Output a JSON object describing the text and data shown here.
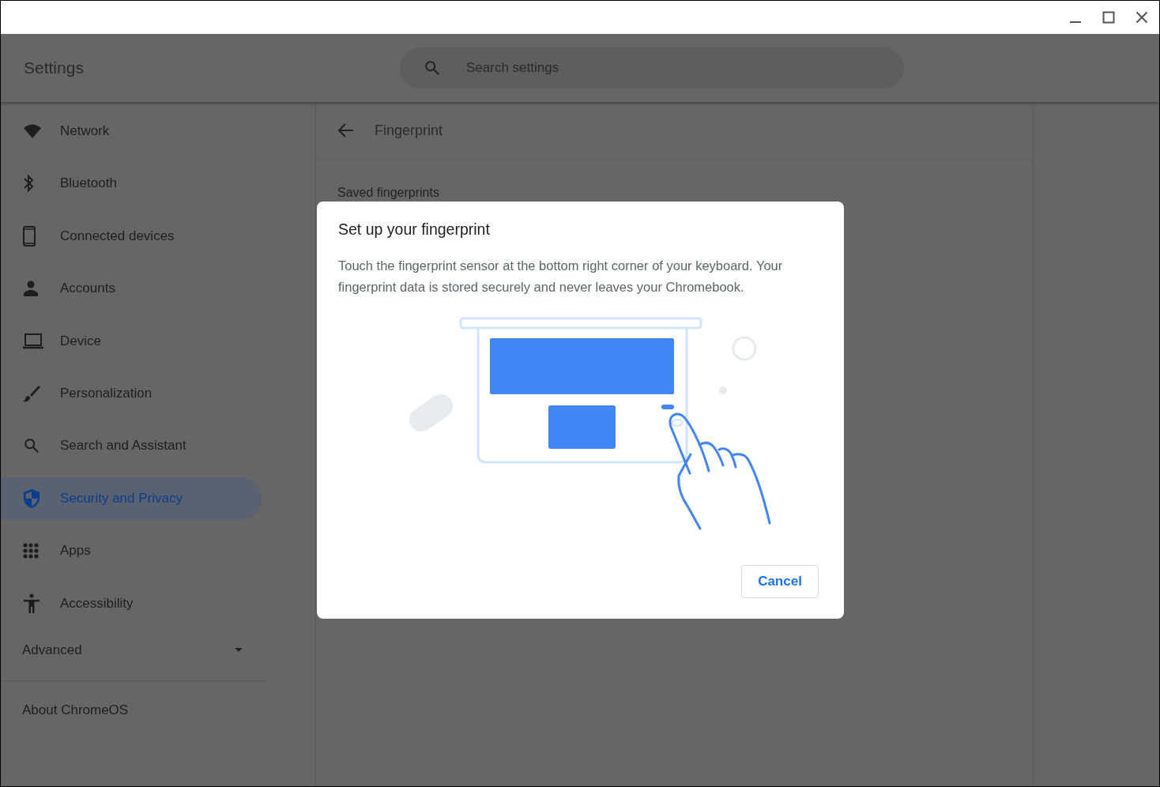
{
  "header": {
    "title": "Settings",
    "search": {
      "placeholder": "Search settings"
    }
  },
  "sidebar": {
    "items": [
      {
        "label": "Network",
        "selected": false
      },
      {
        "label": "Bluetooth",
        "selected": false
      },
      {
        "label": "Connected devices",
        "selected": false
      },
      {
        "label": "Accounts",
        "selected": false
      },
      {
        "label": "Device",
        "selected": false
      },
      {
        "label": "Personalization",
        "selected": false
      },
      {
        "label": "Search and Assistant",
        "selected": false
      },
      {
        "label": "Security and Privacy",
        "selected": true
      },
      {
        "label": "Apps",
        "selected": false
      },
      {
        "label": "Accessibility",
        "selected": false
      }
    ],
    "advanced": {
      "label": "Advanced",
      "expanded": false
    },
    "about": "About ChromeOS"
  },
  "page": {
    "title": "Fingerprint",
    "section": "Saved fingerprints"
  },
  "dialog": {
    "title": "Set up your fingerprint",
    "body": "Touch the fingerprint sensor at the bottom right corner of your keyboard. Your fingerprint data is stored securely and never leaves your Chromebook.",
    "buttons": [
      "Cancel"
    ]
  }
}
